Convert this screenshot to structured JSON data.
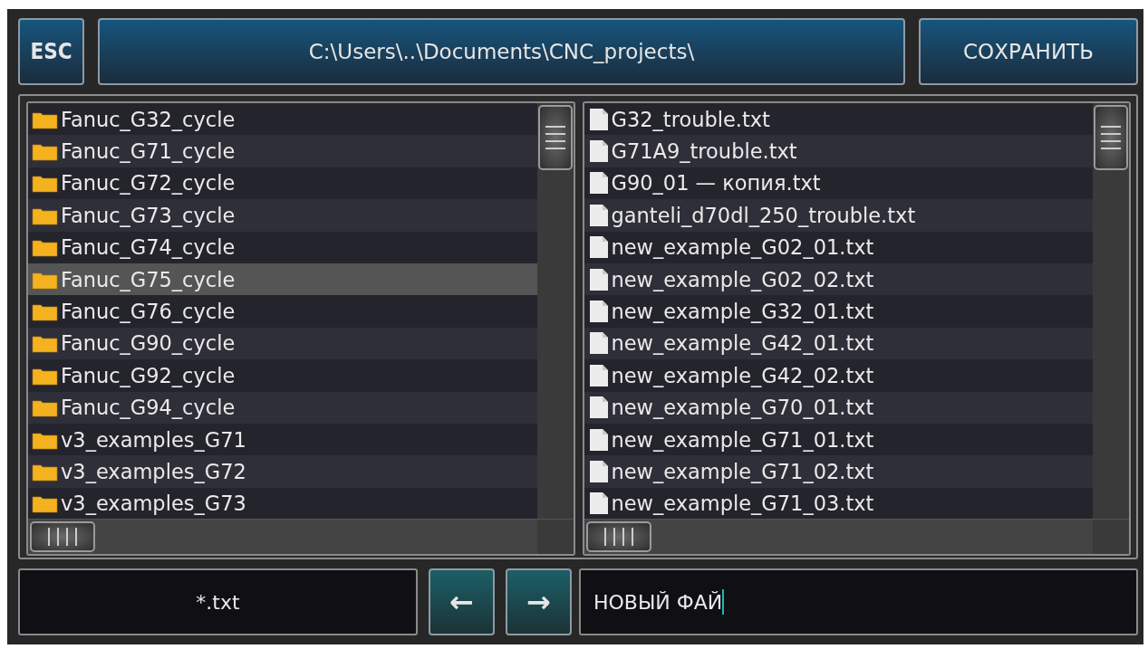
{
  "toolbar": {
    "escape_button": "ESC",
    "path": "C:\\Users\\..\\Documents\\CNC_projects\\",
    "save_button": "СОХРАНИТЬ"
  },
  "folders": [
    {
      "name": "Fanuc_G32_cycle",
      "selected": false
    },
    {
      "name": "Fanuc_G71_cycle",
      "selected": false
    },
    {
      "name": "Fanuc_G72_cycle",
      "selected": false
    },
    {
      "name": "Fanuc_G73_cycle",
      "selected": false
    },
    {
      "name": "Fanuc_G74_cycle",
      "selected": false
    },
    {
      "name": "Fanuc_G75_cycle",
      "selected": true
    },
    {
      "name": "Fanuc_G76_cycle",
      "selected": false
    },
    {
      "name": "Fanuc_G90_cycle",
      "selected": false
    },
    {
      "name": "Fanuc_G92_cycle",
      "selected": false
    },
    {
      "name": "Fanuc_G94_cycle",
      "selected": false
    },
    {
      "name": "v3_examples_G71",
      "selected": false
    },
    {
      "name": "v3_examples_G72",
      "selected": false
    },
    {
      "name": "v3_examples_G73",
      "selected": false
    }
  ],
  "files": [
    {
      "name": "G32_trouble.txt",
      "selected": false
    },
    {
      "name": "G71A9_trouble.txt",
      "selected": false
    },
    {
      "name": "G90_01 — копия.txt",
      "selected": false
    },
    {
      "name": "ganteli_d70dl_250_trouble.txt",
      "selected": false
    },
    {
      "name": "new_example_G02_01.txt",
      "selected": false
    },
    {
      "name": "new_example_G02_02.txt",
      "selected": false
    },
    {
      "name": "new_example_G32_01.txt",
      "selected": false
    },
    {
      "name": "new_example_G42_01.txt",
      "selected": false
    },
    {
      "name": "new_example_G42_02.txt",
      "selected": false
    },
    {
      "name": "new_example_G70_01.txt",
      "selected": false
    },
    {
      "name": "new_example_G71_01.txt",
      "selected": false
    },
    {
      "name": "new_example_G71_02.txt",
      "selected": false
    },
    {
      "name": "new_example_G71_03.txt",
      "selected": false
    }
  ],
  "bottom": {
    "filter": "*.txt",
    "back_button": "←",
    "forward_button": "→",
    "file_name": "НОВЫЙ ФАЙ"
  }
}
